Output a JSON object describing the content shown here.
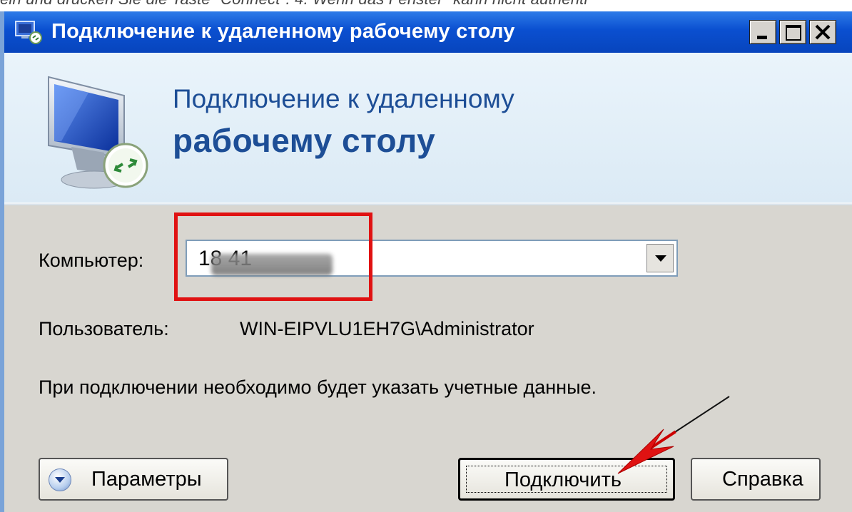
{
  "top_strip": {
    "text": "ein und drücken Sie die Taste \"Connect\". 4. Wenn das Fenster \"kann nicht authenti"
  },
  "window": {
    "title": "Подключение к удаленному рабочему столу",
    "controls": {
      "minimize": "minimize",
      "maximize": "maximize",
      "close": "close"
    }
  },
  "banner": {
    "line1": "Подключение к удаленному",
    "line2": "рабочему столу"
  },
  "form": {
    "computer_label": "Компьютер:",
    "computer_value": "18      41",
    "user_label": "Пользователь:",
    "user_value": "WIN-EIPVLU1EH7G\\Administrator",
    "info_text": "При подключении необходимо будет указать учетные данные."
  },
  "buttons": {
    "params": "Параметры",
    "connect": "Подключить",
    "help": "Справка"
  },
  "colors": {
    "titlebar": "#0a4fd0",
    "highlight": "#e01212",
    "heading": "#1d4e96"
  }
}
